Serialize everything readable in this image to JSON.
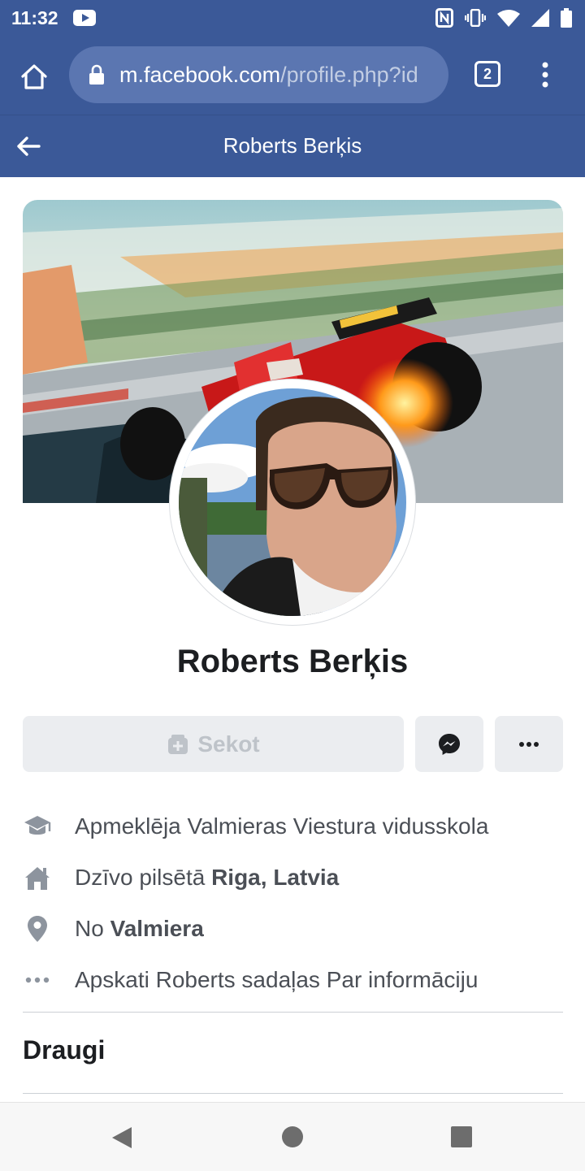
{
  "status_bar": {
    "time": "11:32",
    "icons": [
      "youtube-notification-icon",
      "nfc-icon",
      "vibrate-icon",
      "wifi-icon",
      "cell-signal-icon",
      "battery-icon"
    ]
  },
  "browser": {
    "url_domain": "m.facebook.com",
    "url_path": "/profile.php?id",
    "tab_count": "2",
    "icons": [
      "home-icon",
      "lock-icon",
      "tabs-icon",
      "kebab-menu-icon"
    ]
  },
  "header": {
    "title": "Roberts Berķis",
    "back_icon": "arrow-left-icon"
  },
  "profile": {
    "name": "Roberts Berķis",
    "cover_photo": "formula-car-racing-photo",
    "avatar": "man-with-aviator-sunglasses-photo"
  },
  "actions": {
    "follow_label": "Sekot",
    "follow_icon": "follow-plus-icon",
    "messenger_icon": "messenger-icon",
    "more_icon": "more-dots-icon"
  },
  "intro": [
    {
      "icon": "graduation-cap-icon",
      "text": "Apmeklēja Valmieras Viestura vidusskola"
    },
    {
      "icon": "home-icon",
      "prefix": "Dzīvo pilsētā ",
      "bold": "Riga, Latvia"
    },
    {
      "icon": "location-pin-icon",
      "prefix": "No ",
      "bold": "Valmiera"
    },
    {
      "icon": "more-dots-icon",
      "text": "Apskati Roberts sadaļas Par informāciju"
    }
  ],
  "friends_section": {
    "title": "Draugi"
  },
  "colors": {
    "facebook_blue": "#3b5998",
    "url_box": "#5b76b1",
    "button_gray": "#ebedf0",
    "disabled_text": "#bec3c9",
    "secondary_text": "#4b4f56"
  }
}
